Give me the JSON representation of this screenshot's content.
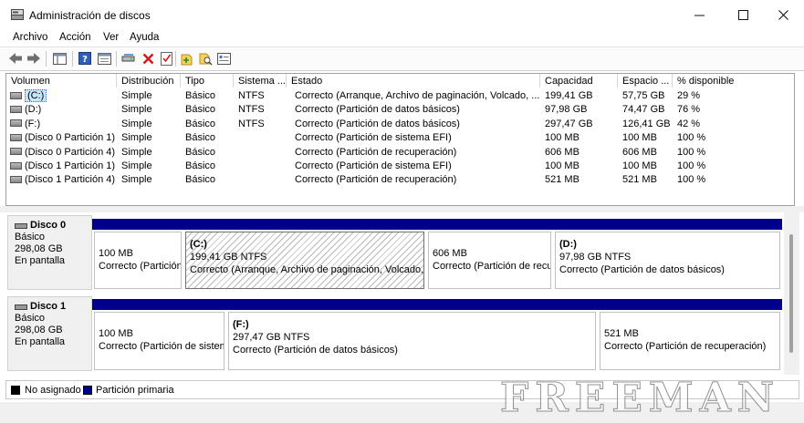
{
  "window": {
    "title": "Administración de discos",
    "minimize_icon": "minimize-icon",
    "maximize_icon": "maximize-icon",
    "close_icon": "close-icon"
  },
  "menu": [
    "Archivo",
    "Acción",
    "Ver",
    "Ayuda"
  ],
  "toolbar": [
    "back-arrow-icon",
    "forward-arrow-icon",
    "console-tree-icon",
    "help-icon",
    "properties-icon",
    "connect-drive-icon",
    "delete-icon",
    "checklist-icon",
    "new-folder-icon",
    "search-folder-icon",
    "view-icon"
  ],
  "volumes": {
    "columns": [
      "Volumen",
      "Distribución",
      "Tipo",
      "Sistema ...",
      "Estado",
      "Capacidad",
      "Espacio ...",
      "% disponible"
    ],
    "rows": [
      [
        "(C:)",
        "Simple",
        "Básico",
        "NTFS",
        "Correcto (Arranque, Archivo de paginación, Volcado, ...",
        "199,41 GB",
        "57,75 GB",
        "29 %"
      ],
      [
        "(D:)",
        "Simple",
        "Básico",
        "NTFS",
        "Correcto (Partición de datos básicos)",
        "97,98 GB",
        "74,47 GB",
        "76 %"
      ],
      [
        "(F:)",
        "Simple",
        "Básico",
        "NTFS",
        "Correcto (Partición de datos básicos)",
        "297,47 GB",
        "126,41 GB",
        "42 %"
      ],
      [
        "(Disco 0 Partición 1)",
        "Simple",
        "Básico",
        "",
        "Correcto (Partición de sistema EFI)",
        "100 MB",
        "100 MB",
        "100 %"
      ],
      [
        "(Disco 0 Partición 4)",
        "Simple",
        "Básico",
        "",
        "Correcto (Partición de recuperación)",
        "606 MB",
        "606 MB",
        "100 %"
      ],
      [
        "(Disco 1 Partición 1)",
        "Simple",
        "Básico",
        "",
        "Correcto (Partición de sistema EFI)",
        "100 MB",
        "100 MB",
        "100 %"
      ],
      [
        "(Disco 1 Partición 4)",
        "Simple",
        "Básico",
        "",
        "Correcto (Partición de recuperación)",
        "521 MB",
        "521 MB",
        "100 %"
      ]
    ]
  },
  "disks": [
    {
      "name": "Disco 0",
      "type": "Básico",
      "size": "298,08 GB",
      "status": "En pantalla",
      "partitions": [
        {
          "letter": "",
          "size": "100 MB",
          "status": "Correcto (Partición de sistema EFI)"
        },
        {
          "letter": "(C:)",
          "size": "199,41 GB NTFS",
          "status": "Correcto (Arranque, Archivo de paginación, Volcado, Partición de datos básicos)"
        },
        {
          "letter": "",
          "size": "606 MB",
          "status": "Correcto (Partición de recuperación)"
        },
        {
          "letter": "(D:)",
          "size": "97,98 GB NTFS",
          "status": "Correcto (Partición de datos básicos)"
        }
      ]
    },
    {
      "name": "Disco 1",
      "type": "Básico",
      "size": "298,08 GB",
      "status": "En pantalla",
      "partitions": [
        {
          "letter": "",
          "size": "100 MB",
          "status": "Correcto (Partición de sistema EFI)"
        },
        {
          "letter": "(F:)",
          "size": "297,47 GB NTFS",
          "status": "Correcto (Partición de datos básicos)"
        },
        {
          "letter": "",
          "size": "521 MB",
          "status": "Correcto (Partición de recuperación)"
        }
      ]
    }
  ],
  "legend": [
    {
      "label": "No asignado",
      "color": "#000000"
    },
    {
      "label": "Partición primaria",
      "color": "#00008c"
    }
  ],
  "watermark": "FREEMAN",
  "colors": {
    "primary_partition": "#00008c",
    "selection": "#cce4f7"
  }
}
